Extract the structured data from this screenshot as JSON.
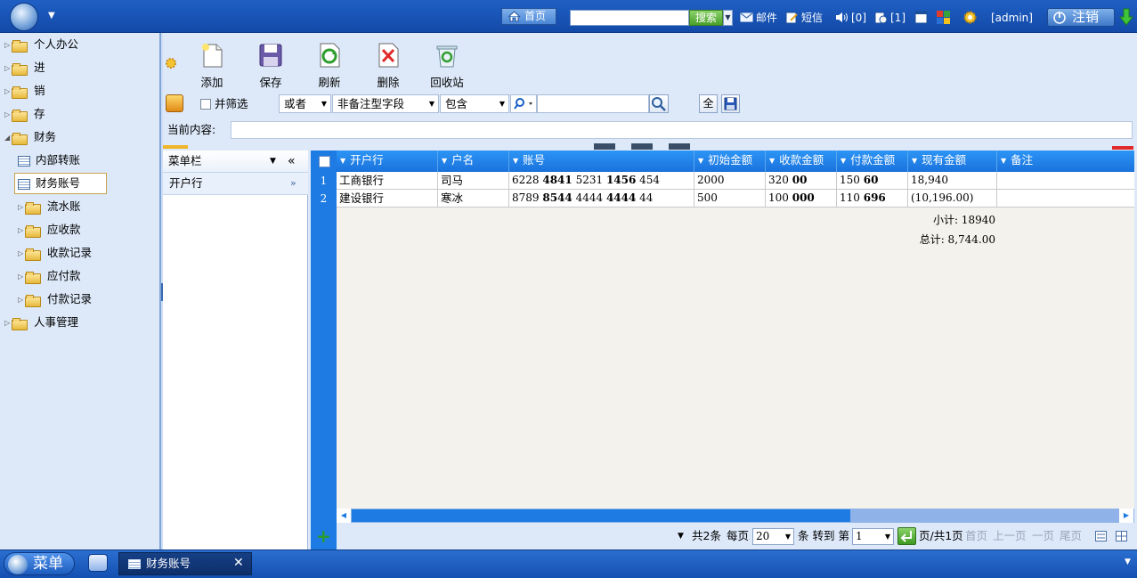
{
  "topbar": {
    "home": "首页",
    "search_value": "",
    "search_btn": "搜索",
    "mail": "邮件",
    "sms": "短信",
    "sound_count": "[0]",
    "notice_count": "[1]",
    "user": "[admin]",
    "logout": "注销"
  },
  "sidebar": {
    "items": [
      {
        "label": "个人办公"
      },
      {
        "label": "进"
      },
      {
        "label": "销"
      },
      {
        "label": "存"
      },
      {
        "label": "财务"
      },
      {
        "label": "内部转账"
      },
      {
        "label": "财务账号"
      },
      {
        "label": "流水账"
      },
      {
        "label": "应收款"
      },
      {
        "label": "收款记录"
      },
      {
        "label": "应付款"
      },
      {
        "label": "付款记录"
      },
      {
        "label": "人事管理"
      }
    ]
  },
  "toolbar": {
    "add": "添加",
    "save": "保存",
    "refresh": "刷新",
    "delete": "删除",
    "recycle": "回收站"
  },
  "filter": {
    "and_filter": "并筛选",
    "logic": "或者",
    "field": "非备注型字段",
    "op": "包含",
    "value": "",
    "all_btn": "全"
  },
  "current": {
    "label": "当前内容:",
    "value": ""
  },
  "menu_panel": {
    "title": "菜单栏",
    "row": "开户行"
  },
  "grid": {
    "columns": [
      "开户行",
      "户名",
      "账号",
      "初始金额",
      "收款金额",
      "付款金额",
      "现有金额",
      "备注"
    ],
    "rows": [
      {
        "num": "1",
        "bank": "工商银行",
        "name": "司马",
        "acct": [
          "6228 ",
          "4841",
          " 5231 ",
          "1456",
          " 454"
        ],
        "init": "2000",
        "recv": [
          "320 ",
          "00"
        ],
        "pay": [
          "150 ",
          "60"
        ],
        "now": "18,940",
        "note": ""
      },
      {
        "num": "2",
        "bank": "建设银行",
        "name": "寒冰",
        "acct": [
          "8789 ",
          "8544",
          " 4444 ",
          "4444",
          " 44"
        ],
        "init": "500",
        "recv": [
          "100 ",
          "000"
        ],
        "pay": [
          "110 ",
          "696"
        ],
        "now": "(10,196.00)",
        "note": ""
      }
    ],
    "subtotal": "小计: 18940",
    "total": "总计: 8,744.00"
  },
  "pager": {
    "total": "共2条",
    "per_page_label": "每页",
    "per_page": "20",
    "goto_label": "条 转到 第",
    "page": "1",
    "page_of": "页/共1页",
    "first": "首页",
    "prev": "上一页",
    "next": "一页",
    "last": "尾页"
  },
  "taskbar": {
    "start": "菜单",
    "tab": "财务账号",
    "close": "✕"
  },
  "colors": {
    "topbar": "#1a56b8",
    "grid_header": "#1f80e6",
    "sidebar_bg": "#dde9f9"
  }
}
